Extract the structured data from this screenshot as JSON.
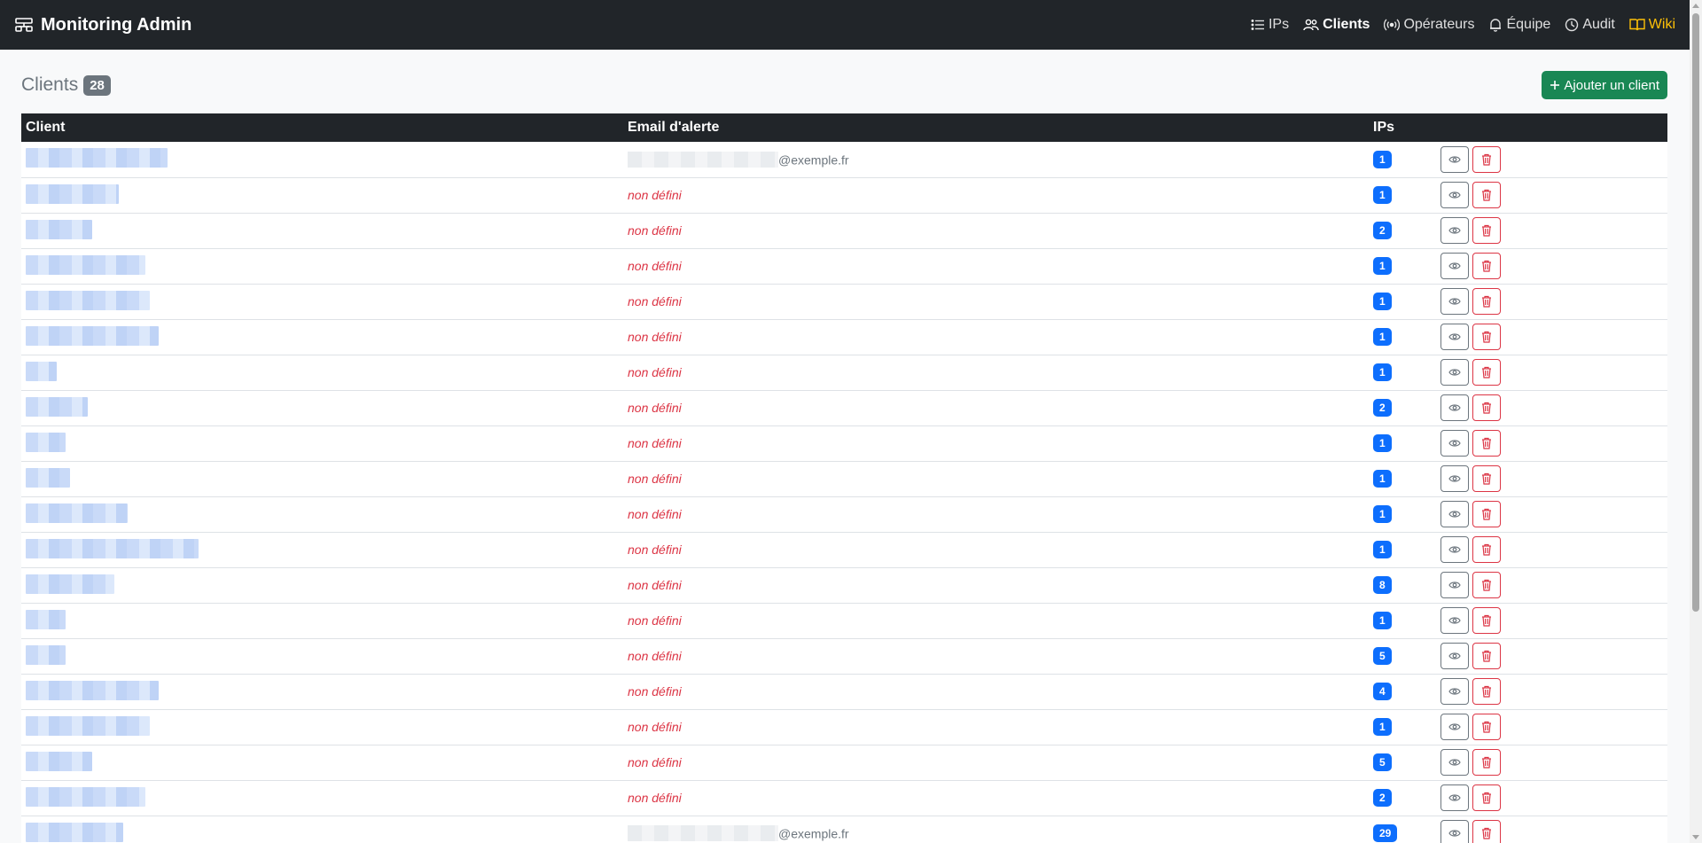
{
  "navbar": {
    "brand": "Monitoring Admin",
    "items": [
      {
        "key": "ips",
        "label": "IPs",
        "icon": "list-icon"
      },
      {
        "key": "clients",
        "label": "Clients",
        "icon": "people-icon",
        "active": true
      },
      {
        "key": "operateurs",
        "label": "Opérateurs",
        "icon": "broadcast-icon"
      },
      {
        "key": "equipe",
        "label": "Équipe",
        "icon": "bell-icon"
      },
      {
        "key": "audit",
        "label": "Audit",
        "icon": "clock-icon"
      },
      {
        "key": "wiki",
        "label": "Wiki",
        "icon": "book-icon"
      }
    ]
  },
  "page": {
    "title": "Clients",
    "count": "28",
    "add_button": "Ajouter un client"
  },
  "table": {
    "columns": [
      "Client",
      "Email d'alerte",
      "IPs"
    ],
    "rows": [
      {
        "email": "@exemple.fr",
        "ips": "1"
      },
      {
        "email": "non défini",
        "ips": "1"
      },
      {
        "email": "non défini",
        "ips": "2"
      },
      {
        "email": "non défini",
        "ips": "1"
      },
      {
        "email": "non défini",
        "ips": "1"
      },
      {
        "email": "non défini",
        "ips": "1"
      },
      {
        "email": "non défini",
        "ips": "1"
      },
      {
        "email": "non défini",
        "ips": "2"
      },
      {
        "email": "non défini",
        "ips": "1"
      },
      {
        "email": "non défini",
        "ips": "1"
      },
      {
        "email": "non défini",
        "ips": "1"
      },
      {
        "email": "non défini",
        "ips": "1"
      },
      {
        "email": "non défini",
        "ips": "8"
      },
      {
        "email": "non défini",
        "ips": "1"
      },
      {
        "email": "non défini",
        "ips": "5"
      },
      {
        "email": "non défini",
        "ips": "4"
      },
      {
        "email": "non défini",
        "ips": "1"
      },
      {
        "email": "non défini",
        "ips": "5"
      },
      {
        "email": "non défini",
        "ips": "2"
      },
      {
        "email": "@exemple.fr",
        "ips": "29"
      }
    ]
  },
  "colors": {
    "navbar_bg": "#212529",
    "wiki": "#ffc107",
    "success": "#198754",
    "primary": "#0d6efd",
    "danger": "#dc3545",
    "secondary": "#6c757d"
  }
}
